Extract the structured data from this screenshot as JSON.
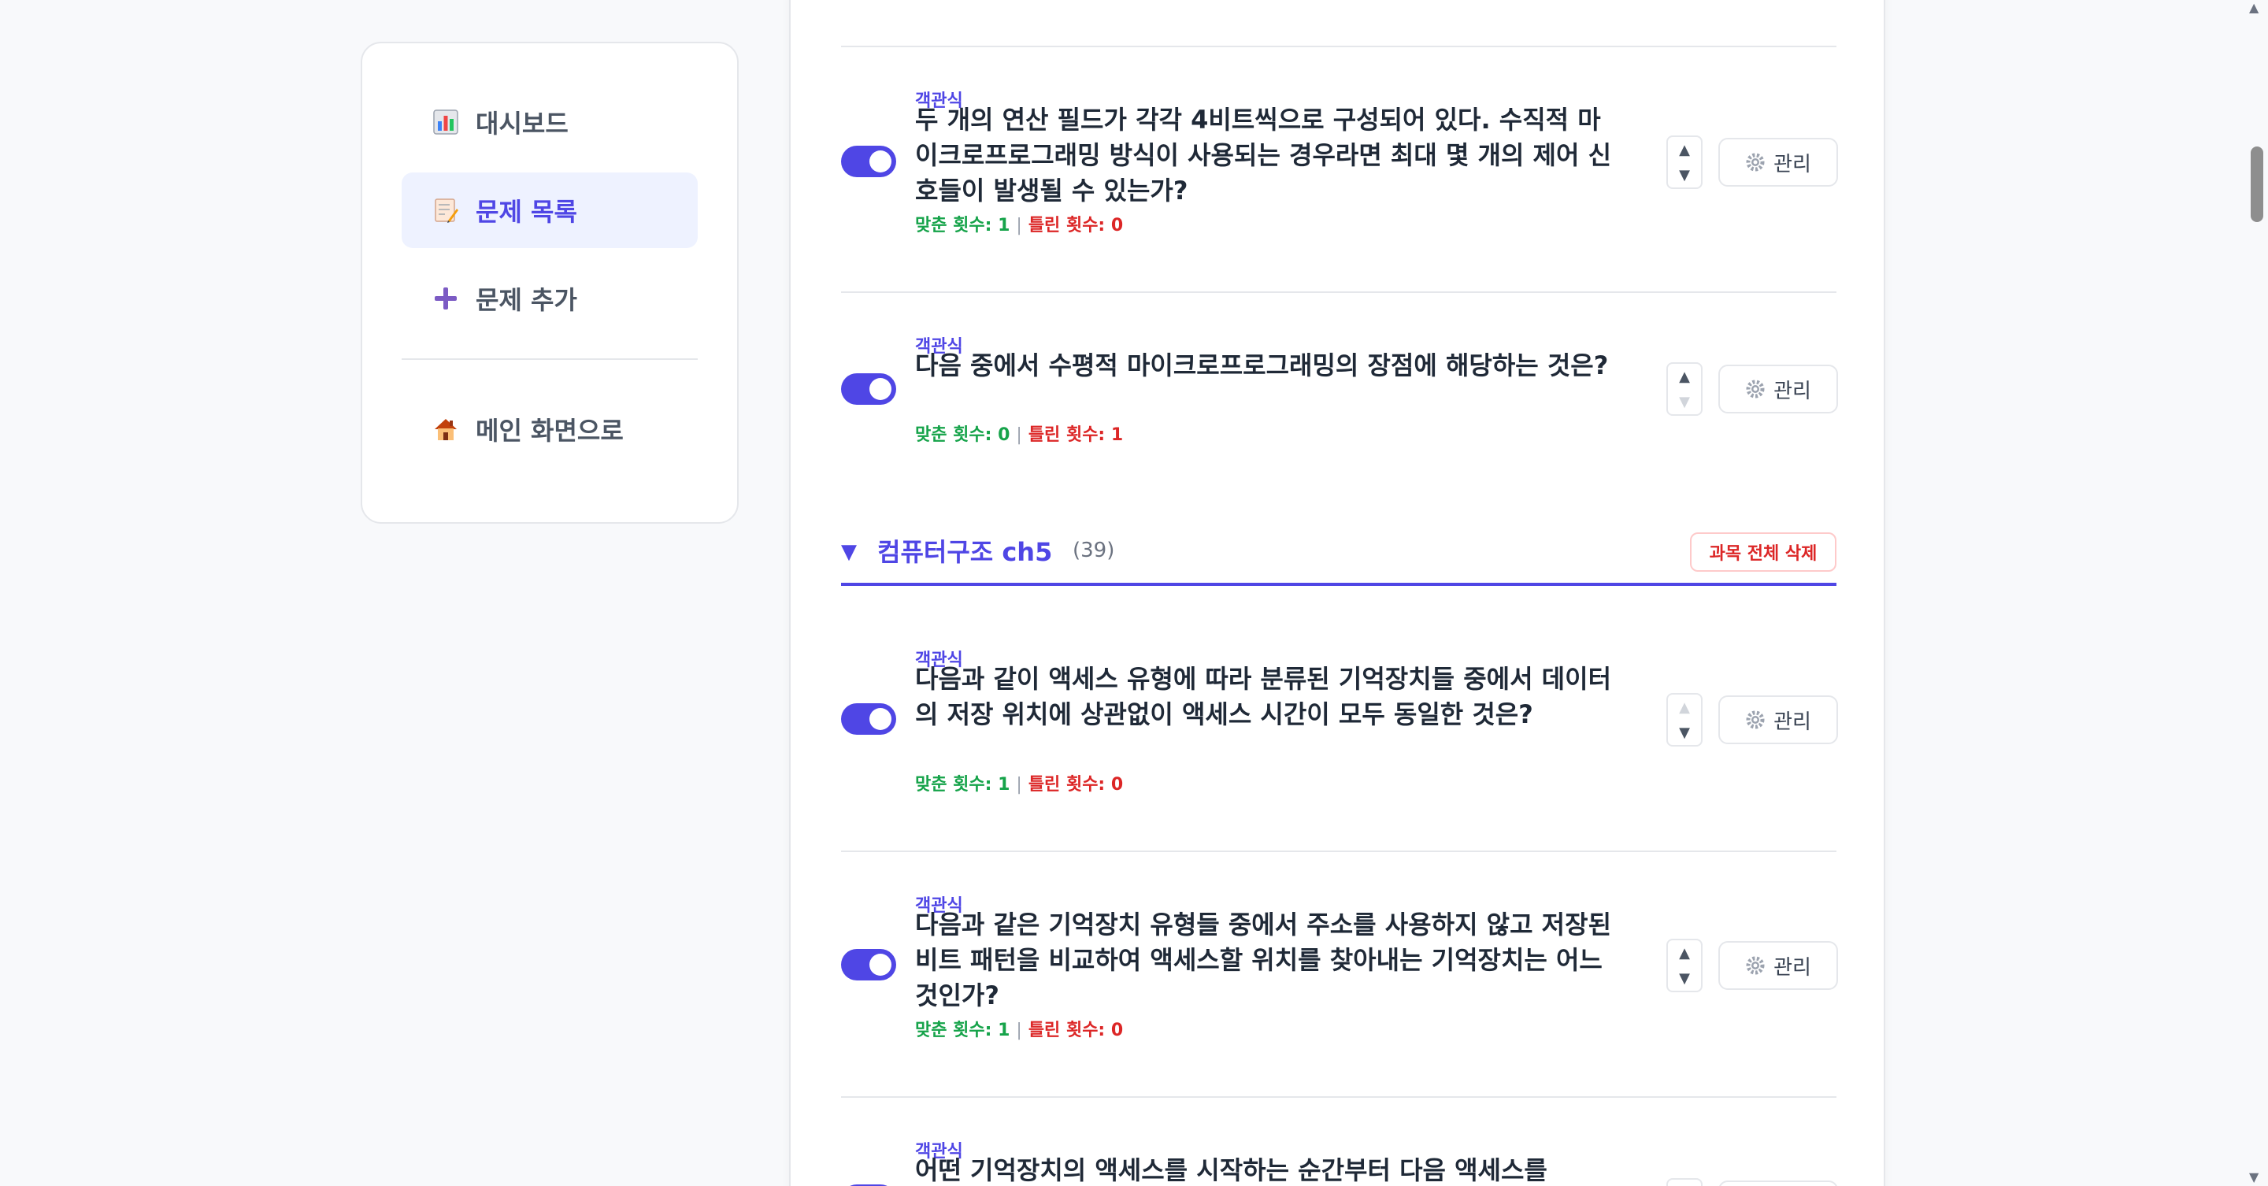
{
  "sidebar": {
    "items": [
      {
        "label": "대시보드",
        "icon": "bar-chart-icon",
        "active": false
      },
      {
        "label": "문제 목록",
        "icon": "memo-icon",
        "active": true
      },
      {
        "label": "문제 추가",
        "icon": "plus-icon",
        "active": false
      }
    ],
    "home": {
      "label": "메인 화면으로",
      "icon": "house-icon"
    }
  },
  "questions_above": [
    {
      "type": "객관식",
      "text": "두 개의 연산 필드가 각각 4비트씩으로 구성되어 있다. 수직적 마이크로프로그래밍 방식이 사용되는 경우라면 최대 몇 개의 제어 신호들이 발생될 수 있는가?",
      "correct_label": "맞춘 횟수: 1",
      "wrong_label": "틀린 횟수: 0",
      "enabled": true
    },
    {
      "type": "객관식",
      "text": "다음 중에서 수평적 마이크로프로그래밍의 장점에 해당하는 것은?",
      "correct_label": "맞춘 횟수: 0",
      "wrong_label": "틀린 횟수: 1",
      "enabled": true
    }
  ],
  "section": {
    "title": "컴퓨터구조 ch5",
    "count": "(39)",
    "delete_label": "과목 전체 삭제"
  },
  "questions_section": [
    {
      "type": "객관식",
      "text": "다음과 같이 액세스 유형에 따라 분류된 기억장치들 중에서 데이터의 저장 위치에 상관없이 액세스 시간이 모두 동일한 것은?",
      "correct_label": "맞춘 횟수: 1",
      "wrong_label": "틀린 횟수: 0",
      "enabled": true
    },
    {
      "type": "객관식",
      "text": "다음과 같은 기억장치 유형들 중에서 주소를 사용하지 않고 저장된 비트 패턴을 비교하여 액세스할 위치를 찾아내는 기억장치는 어느 것인가?",
      "correct_label": "맞춘 횟수: 1",
      "wrong_label": "틀린 횟수: 0",
      "enabled": true
    },
    {
      "type": "객관식",
      "text": "어떤 기억장치의 액세스를 시작하는 순간부터 다음 액세스를",
      "enabled": true
    }
  ],
  "manage_label": "관리",
  "arrow_up": "▲",
  "arrow_down": "▼",
  "colors": {
    "accent": "#4f46e5",
    "correct": "#16a34a",
    "wrong": "#dc2626"
  }
}
